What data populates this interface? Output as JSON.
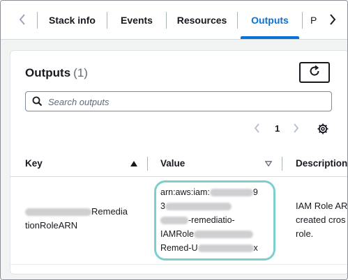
{
  "tabs": {
    "items": [
      {
        "label": "Stack info"
      },
      {
        "label": "Events"
      },
      {
        "label": "Resources"
      },
      {
        "label": "Outputs",
        "active": true
      },
      {
        "label": "P"
      }
    ]
  },
  "outputs": {
    "title": "Outputs",
    "count": "(1)",
    "search_placeholder": "Search outputs",
    "page": "1"
  },
  "table": {
    "headers": {
      "key": "Key",
      "value": "Value",
      "description": "Description"
    },
    "row": {
      "key_line1": "Remedia",
      "key_line2": "tionRoleARN",
      "value_line1": "arn:aws:iam:",
      "value_line1_end": "9",
      "value_line2": "3",
      "value_line3": "-remediatio-",
      "value_line4": "IAMRole",
      "value_line5": "Remed-U",
      "value_line5_end": "x",
      "desc_line1": "IAM Role AR",
      "desc_line2": "created cros",
      "desc_line3": "role."
    }
  },
  "colors": {
    "accent": "#0972d3",
    "highlight": "#7ccfcc"
  },
  "icons": [
    "chevron-left-icon",
    "chevron-right-icon",
    "refresh-icon",
    "search-icon",
    "settings-icon",
    "sort-ascending-icon",
    "sort-descending-icon"
  ]
}
